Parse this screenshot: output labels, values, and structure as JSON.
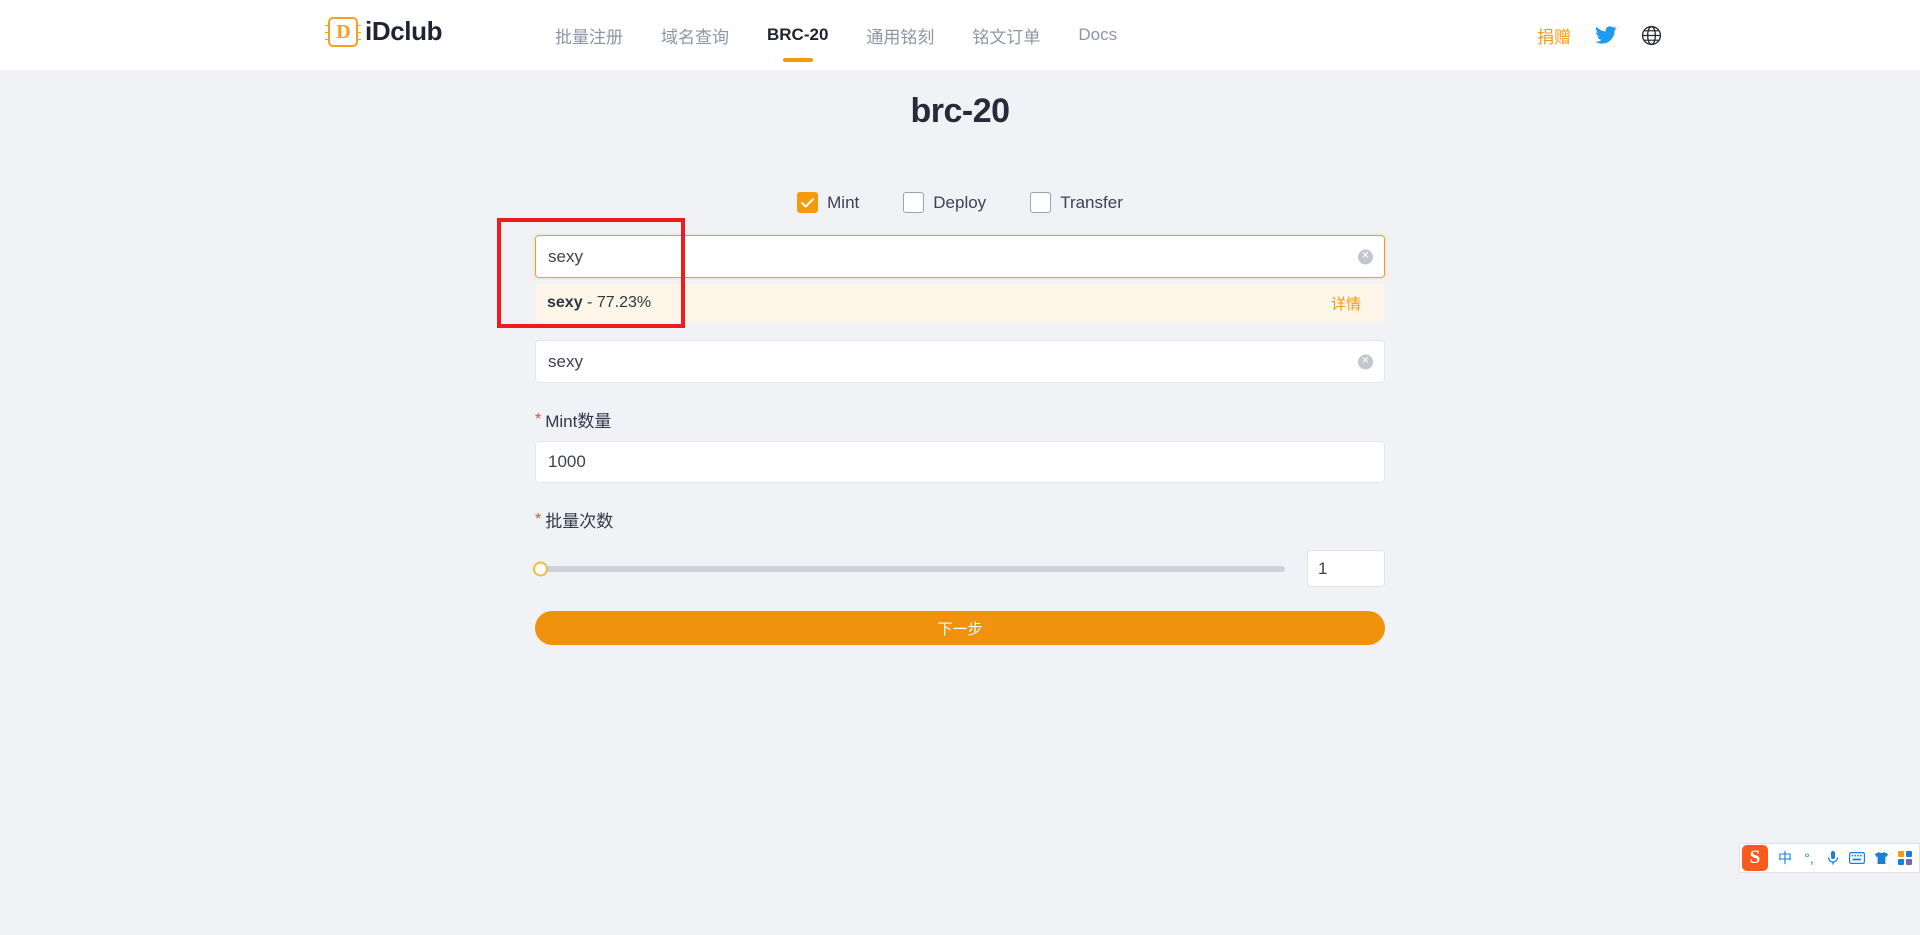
{
  "header": {
    "logo": {
      "mark": "D",
      "text": "iDclub"
    },
    "nav": [
      {
        "label": "批量注册",
        "active": false
      },
      {
        "label": "域名查询",
        "active": false
      },
      {
        "label": "BRC-20",
        "active": true
      },
      {
        "label": "通用铭刻",
        "active": false
      },
      {
        "label": "铭文订单",
        "active": false
      },
      {
        "label": "Docs",
        "active": false
      }
    ],
    "donate_label": "捐赠",
    "twitter_icon": "twitter-icon",
    "language_icon": "globe-icon"
  },
  "main": {
    "title": "brc-20",
    "modes": [
      {
        "label": "Mint",
        "checked": true
      },
      {
        "label": "Deploy",
        "checked": false
      },
      {
        "label": "Transfer",
        "checked": false
      }
    ],
    "ticker_search": {
      "value": "sexy",
      "placeholder": "",
      "clear_icon": "clear-circle-icon",
      "suggestions": [
        {
          "name": "sexy",
          "percent": "- 77.23%",
          "detail_label": "详情"
        }
      ]
    },
    "ticker_field": {
      "value": "sexy",
      "clear_icon": "clear-circle-icon"
    },
    "mint_amount": {
      "label": "Mint数量",
      "required_mark": "*",
      "value": "1000"
    },
    "batch_count": {
      "label": "批量次数",
      "required_mark": "*",
      "slider_value": 1,
      "slider_min": 1,
      "slider_max": 100,
      "value": "1"
    },
    "submit_label": "下一步"
  },
  "ime": {
    "logo": "S",
    "items": [
      "中",
      "°,",
      "mic-icon",
      "keyboard-icon",
      "skin-icon",
      "menu-icon"
    ]
  },
  "colors": {
    "accent": "#f59a0b",
    "annotation": "#ee1c1c",
    "page_bg": "#f0f2f5"
  }
}
